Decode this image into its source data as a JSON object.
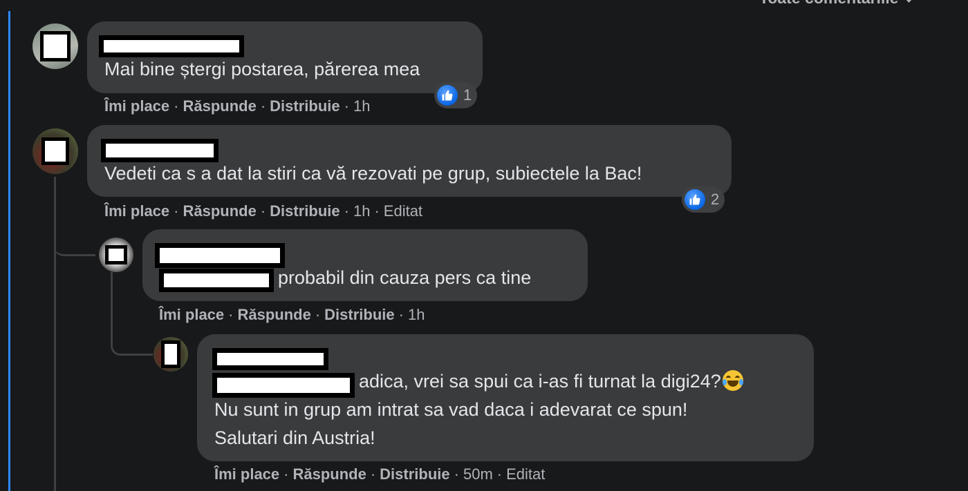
{
  "header": {
    "sort_label": "Toate comentariile"
  },
  "comments": [
    {
      "text": "Mai bine ștergi postarea, părerea mea",
      "actions": {
        "like": "Îmi place",
        "reply": "Răspunde",
        "share": "Distribuie",
        "time": "1h",
        "edited": ""
      },
      "reactions": {
        "count": "1"
      }
    },
    {
      "text": "Vedeti ca s a dat la stiri ca vă rezovati pe grup, subiectele la Bac!",
      "actions": {
        "like": "Îmi place",
        "reply": "Răspunde",
        "share": "Distribuie",
        "time": "1h",
        "edited": "Editat"
      },
      "reactions": {
        "count": "2"
      }
    },
    {
      "text": "probabil din cauza pers ca tine",
      "actions": {
        "like": "Îmi place",
        "reply": "Răspunde",
        "share": "Distribuie",
        "time": "1h",
        "edited": ""
      }
    },
    {
      "text_line1": "adica, vrei sa spui ca i-as fi turnat la digi24?",
      "text_line2": "Nu sunt in grup am intrat sa vad daca i adevarat ce spun!",
      "text_line3": "Salutari din Austria!",
      "emoji": "face-with-tears-of-joy-icon",
      "actions": {
        "like": "Îmi place",
        "reply": "Răspunde",
        "share": "Distribuie",
        "time": "50m",
        "edited": "Editat"
      }
    }
  ],
  "separator": "·",
  "colors": {
    "background": "#18191a",
    "bubble": "#3a3b3c",
    "text": "#e4e6eb",
    "secondary_text": "#b0b3b8",
    "accent": "#2d88ff"
  }
}
